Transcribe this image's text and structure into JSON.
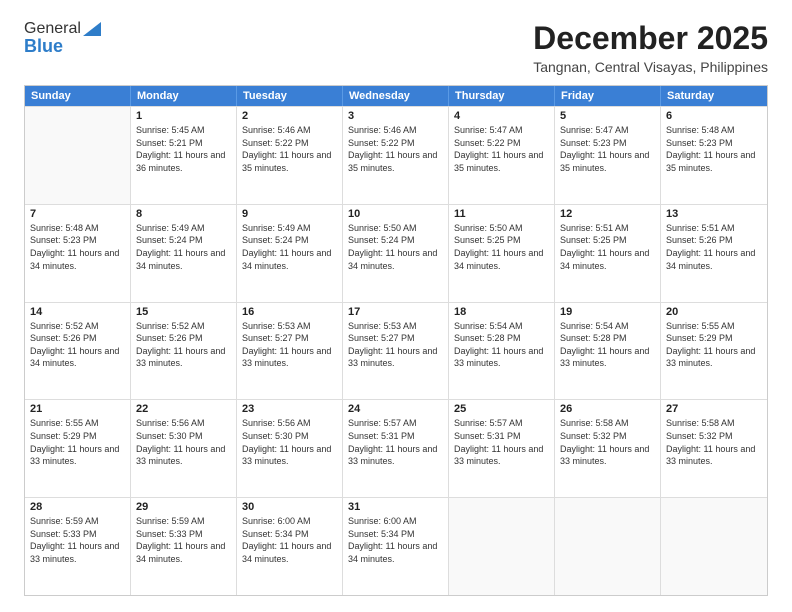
{
  "logo": {
    "line1": "General",
    "line2": "Blue"
  },
  "title": {
    "month": "December 2025",
    "location": "Tangnan, Central Visayas, Philippines"
  },
  "header_days": [
    "Sunday",
    "Monday",
    "Tuesday",
    "Wednesday",
    "Thursday",
    "Friday",
    "Saturday"
  ],
  "weeks": [
    [
      {
        "day": "",
        "sunrise": "",
        "sunset": "",
        "daylight": "",
        "empty": true
      },
      {
        "day": "1",
        "sunrise": "5:45 AM",
        "sunset": "5:21 PM",
        "daylight": "11 hours and 36 minutes."
      },
      {
        "day": "2",
        "sunrise": "5:46 AM",
        "sunset": "5:22 PM",
        "daylight": "11 hours and 35 minutes."
      },
      {
        "day": "3",
        "sunrise": "5:46 AM",
        "sunset": "5:22 PM",
        "daylight": "11 hours and 35 minutes."
      },
      {
        "day": "4",
        "sunrise": "5:47 AM",
        "sunset": "5:22 PM",
        "daylight": "11 hours and 35 minutes."
      },
      {
        "day": "5",
        "sunrise": "5:47 AM",
        "sunset": "5:23 PM",
        "daylight": "11 hours and 35 minutes."
      },
      {
        "day": "6",
        "sunrise": "5:48 AM",
        "sunset": "5:23 PM",
        "daylight": "11 hours and 35 minutes."
      }
    ],
    [
      {
        "day": "7",
        "sunrise": "5:48 AM",
        "sunset": "5:23 PM",
        "daylight": "11 hours and 34 minutes."
      },
      {
        "day": "8",
        "sunrise": "5:49 AM",
        "sunset": "5:24 PM",
        "daylight": "11 hours and 34 minutes."
      },
      {
        "day": "9",
        "sunrise": "5:49 AM",
        "sunset": "5:24 PM",
        "daylight": "11 hours and 34 minutes."
      },
      {
        "day": "10",
        "sunrise": "5:50 AM",
        "sunset": "5:24 PM",
        "daylight": "11 hours and 34 minutes."
      },
      {
        "day": "11",
        "sunrise": "5:50 AM",
        "sunset": "5:25 PM",
        "daylight": "11 hours and 34 minutes."
      },
      {
        "day": "12",
        "sunrise": "5:51 AM",
        "sunset": "5:25 PM",
        "daylight": "11 hours and 34 minutes."
      },
      {
        "day": "13",
        "sunrise": "5:51 AM",
        "sunset": "5:26 PM",
        "daylight": "11 hours and 34 minutes."
      }
    ],
    [
      {
        "day": "14",
        "sunrise": "5:52 AM",
        "sunset": "5:26 PM",
        "daylight": "11 hours and 34 minutes."
      },
      {
        "day": "15",
        "sunrise": "5:52 AM",
        "sunset": "5:26 PM",
        "daylight": "11 hours and 33 minutes."
      },
      {
        "day": "16",
        "sunrise": "5:53 AM",
        "sunset": "5:27 PM",
        "daylight": "11 hours and 33 minutes."
      },
      {
        "day": "17",
        "sunrise": "5:53 AM",
        "sunset": "5:27 PM",
        "daylight": "11 hours and 33 minutes."
      },
      {
        "day": "18",
        "sunrise": "5:54 AM",
        "sunset": "5:28 PM",
        "daylight": "11 hours and 33 minutes."
      },
      {
        "day": "19",
        "sunrise": "5:54 AM",
        "sunset": "5:28 PM",
        "daylight": "11 hours and 33 minutes."
      },
      {
        "day": "20",
        "sunrise": "5:55 AM",
        "sunset": "5:29 PM",
        "daylight": "11 hours and 33 minutes."
      }
    ],
    [
      {
        "day": "21",
        "sunrise": "5:55 AM",
        "sunset": "5:29 PM",
        "daylight": "11 hours and 33 minutes."
      },
      {
        "day": "22",
        "sunrise": "5:56 AM",
        "sunset": "5:30 PM",
        "daylight": "11 hours and 33 minutes."
      },
      {
        "day": "23",
        "sunrise": "5:56 AM",
        "sunset": "5:30 PM",
        "daylight": "11 hours and 33 minutes."
      },
      {
        "day": "24",
        "sunrise": "5:57 AM",
        "sunset": "5:31 PM",
        "daylight": "11 hours and 33 minutes."
      },
      {
        "day": "25",
        "sunrise": "5:57 AM",
        "sunset": "5:31 PM",
        "daylight": "11 hours and 33 minutes."
      },
      {
        "day": "26",
        "sunrise": "5:58 AM",
        "sunset": "5:32 PM",
        "daylight": "11 hours and 33 minutes."
      },
      {
        "day": "27",
        "sunrise": "5:58 AM",
        "sunset": "5:32 PM",
        "daylight": "11 hours and 33 minutes."
      }
    ],
    [
      {
        "day": "28",
        "sunrise": "5:59 AM",
        "sunset": "5:33 PM",
        "daylight": "11 hours and 33 minutes."
      },
      {
        "day": "29",
        "sunrise": "5:59 AM",
        "sunset": "5:33 PM",
        "daylight": "11 hours and 34 minutes."
      },
      {
        "day": "30",
        "sunrise": "6:00 AM",
        "sunset": "5:34 PM",
        "daylight": "11 hours and 34 minutes."
      },
      {
        "day": "31",
        "sunrise": "6:00 AM",
        "sunset": "5:34 PM",
        "daylight": "11 hours and 34 minutes."
      },
      {
        "day": "",
        "sunrise": "",
        "sunset": "",
        "daylight": "",
        "empty": true
      },
      {
        "day": "",
        "sunrise": "",
        "sunset": "",
        "daylight": "",
        "empty": true
      },
      {
        "day": "",
        "sunrise": "",
        "sunset": "",
        "daylight": "",
        "empty": true
      }
    ]
  ]
}
